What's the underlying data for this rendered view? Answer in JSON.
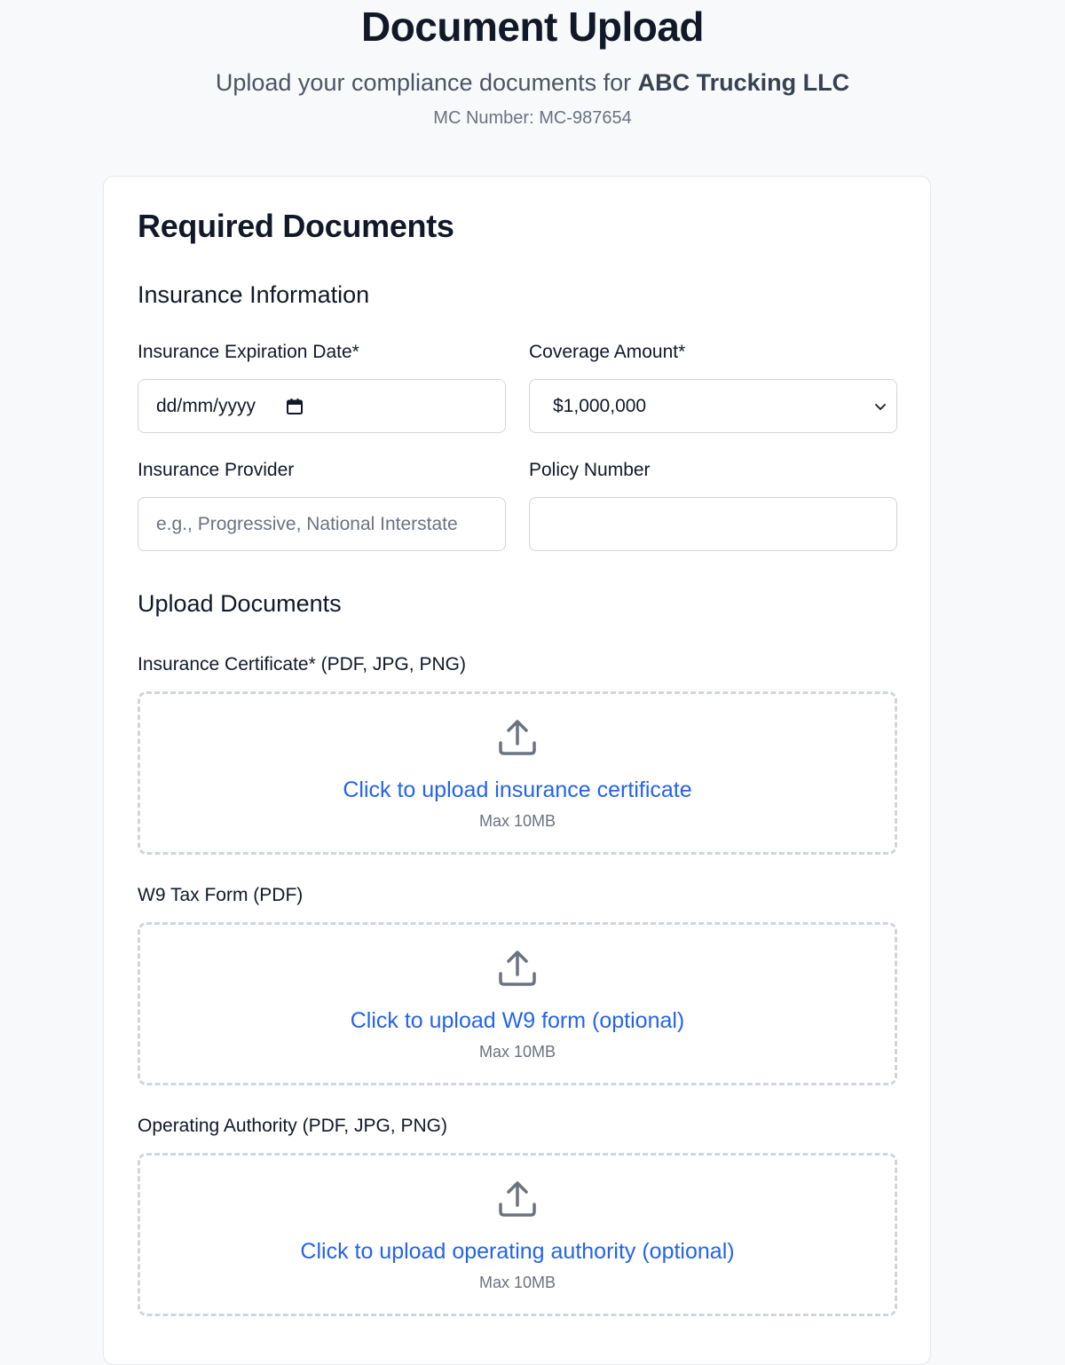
{
  "header": {
    "title": "Document Upload",
    "subtitle_prefix": "Upload your compliance documents for ",
    "company_name": "ABC Trucking LLC",
    "mc_number": "MC Number: MC-987654"
  },
  "card": {
    "title": "Required Documents",
    "insurance_section": {
      "title": "Insurance Information",
      "expiration_label": "Insurance Expiration Date*",
      "expiration_value": "dd/mm/yyyy",
      "coverage_label": "Coverage Amount*",
      "coverage_value": "$1,000,000",
      "provider_label": "Insurance Provider",
      "provider_placeholder": "e.g., Progressive, National Interstate",
      "policy_label": "Policy Number",
      "policy_placeholder": ""
    },
    "upload_section": {
      "title": "Upload Documents",
      "uploads": [
        {
          "label": "Insurance Certificate* (PDF, JPG, PNG)",
          "link": "Click to upload insurance certificate",
          "hint": "Max 10MB"
        },
        {
          "label": "W9 Tax Form (PDF)",
          "link": "Click to upload W9 form (optional)",
          "hint": "Max 10MB"
        },
        {
          "label": "Operating Authority (PDF, JPG, PNG)",
          "link": "Click to upload operating authority (optional)",
          "hint": "Max 10MB"
        }
      ]
    }
  },
  "icons": {
    "calendar": "calendar-icon",
    "chevron": "chevron-down-icon",
    "upload": "upload-icon"
  },
  "colors": {
    "accent": "#2563eb",
    "background": "#f8f9fb",
    "border": "#d1d5db"
  }
}
